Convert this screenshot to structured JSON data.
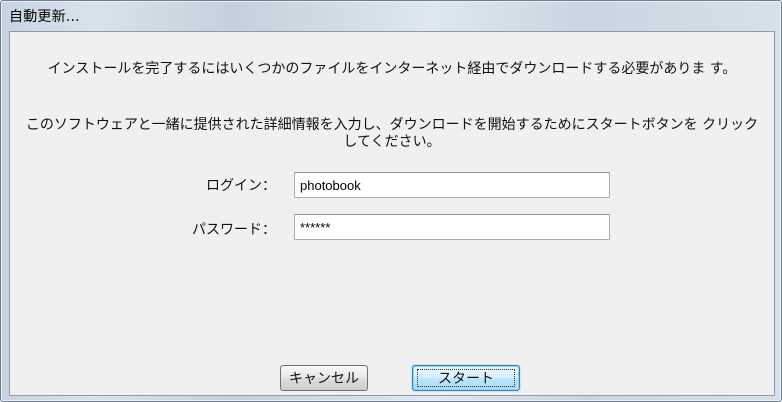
{
  "window": {
    "title": "自動更新..."
  },
  "message": {
    "line1": "インストールを完了するにはいくつかのファイルをインターネット経由でダウンロードする必要がありま す。",
    "line2": "このソフトウェアと一緒に提供された詳細情報を入力し、ダウンロードを開始するためにスタートボタンを クリックしてください。"
  },
  "form": {
    "login_label": "ログイン：",
    "login_value": "photobook",
    "password_label": "パスワード：",
    "password_value": "******"
  },
  "buttons": {
    "cancel_label": "キャンセル",
    "start_label": "スタート"
  }
}
